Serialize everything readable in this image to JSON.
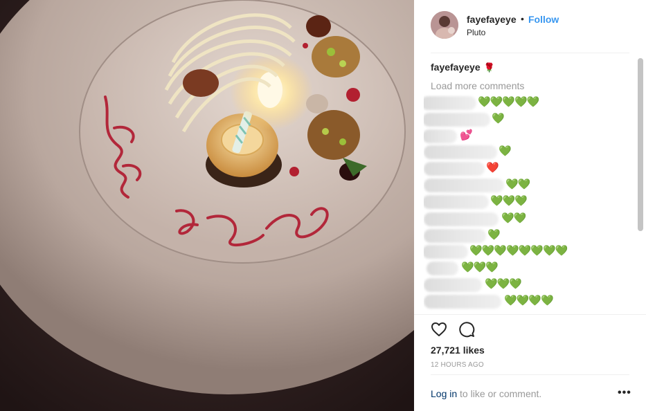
{
  "header": {
    "username": "fayefayeye",
    "separator": "•",
    "follow_label": "Follow",
    "location": "Pluto"
  },
  "caption": {
    "username": "fayefayeye",
    "emoji": "🌹"
  },
  "comments": {
    "load_more_label": "Load more comments",
    "items": [
      {
        "emoji": "💚💚💚💚💚",
        "color": "green"
      },
      {
        "emoji": "💚",
        "color": "green"
      },
      {
        "emoji": "💕",
        "color": "pink"
      },
      {
        "emoji": "💚",
        "color": "green"
      },
      {
        "emoji": "❤️",
        "color": "red"
      },
      {
        "emoji": "💚💚",
        "color": "green"
      },
      {
        "emoji": "💚💚💚",
        "color": "green"
      },
      {
        "emoji": "💚💚",
        "color": "green"
      },
      {
        "emoji": "💚",
        "color": "green"
      },
      {
        "emoji": "💚💚💚💚💚💚💚💚",
        "color": "green"
      },
      {
        "emoji": "💚💚💚",
        "color": "green"
      },
      {
        "emoji": "💚💚💚",
        "color": "green"
      },
      {
        "emoji": "💚💚💚💚",
        "color": "green"
      }
    ]
  },
  "actions": {
    "like_icon": "heart-outline-icon",
    "comment_icon": "comment-bubble-icon"
  },
  "likes_text": "27,721 likes",
  "timestamp": "12 HOURS AGO",
  "footer": {
    "login_link": "Log in",
    "login_suffix": " to like or comment.",
    "more_label": "•••"
  },
  "photo": {
    "plate_writing": "Happy Birthday"
  },
  "colors": {
    "link_blue": "#3897f0",
    "heart_green": "#5bd33d",
    "heart_red": "#e0263a"
  }
}
